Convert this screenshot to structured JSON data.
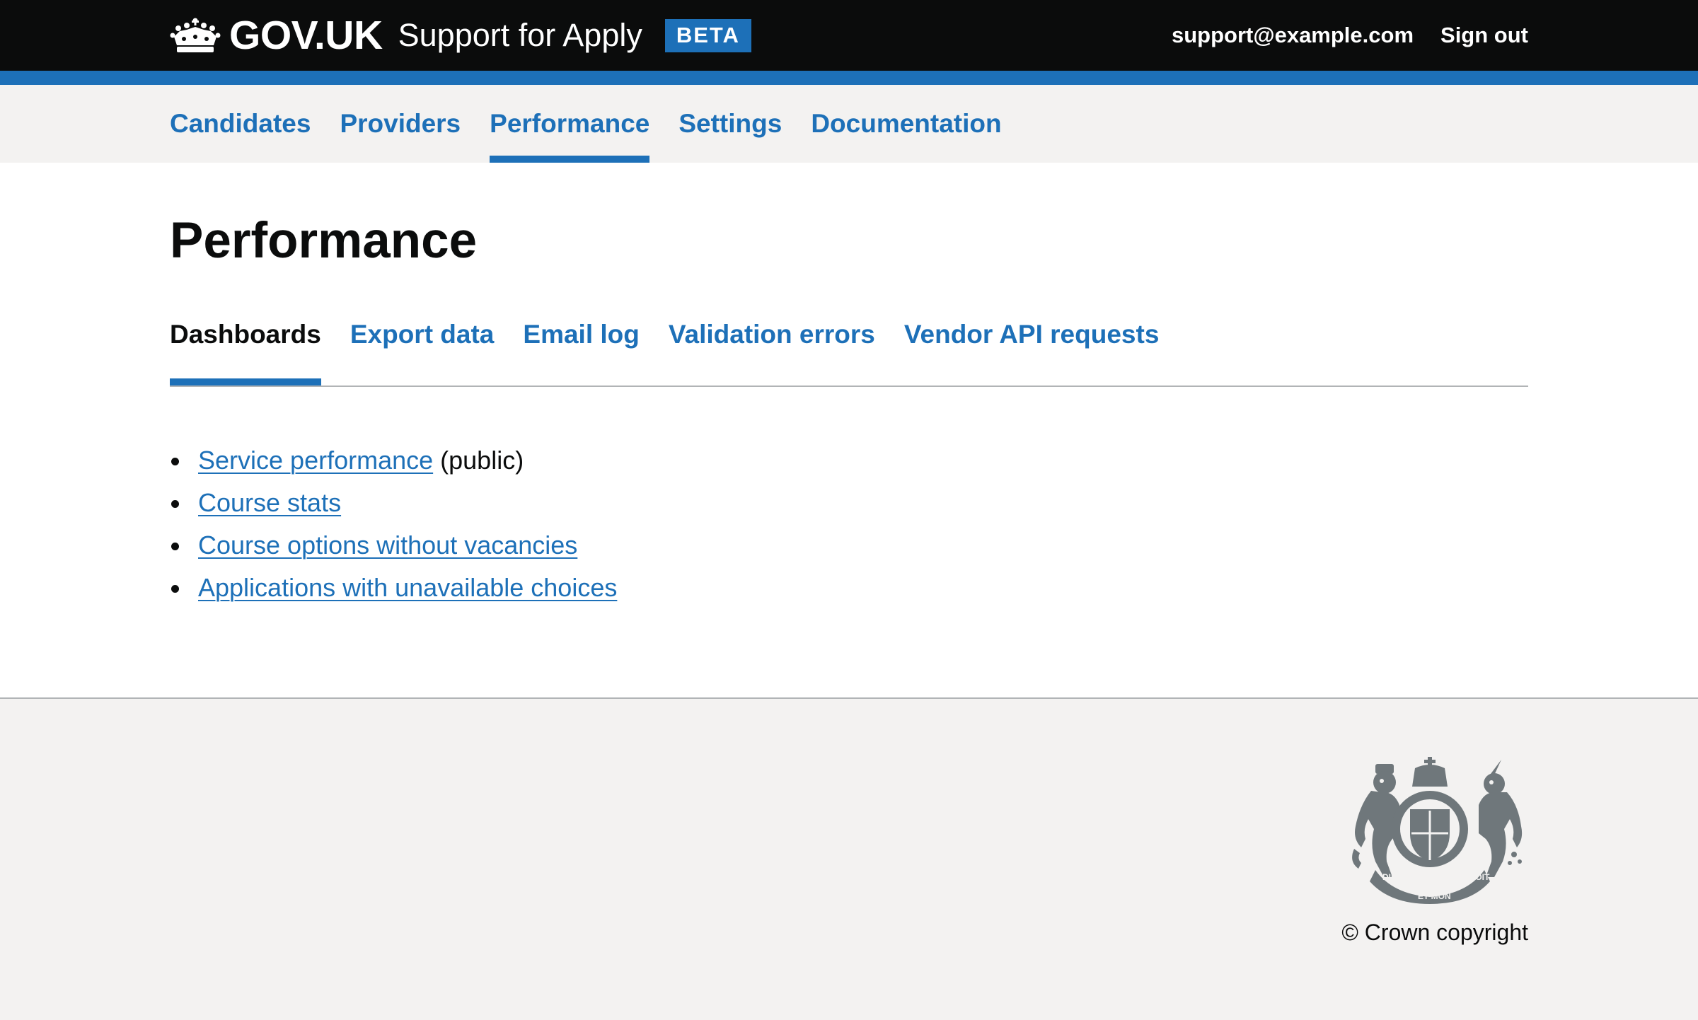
{
  "header": {
    "logotype": "GOV.UK",
    "service_name": "Support for Apply",
    "phase_tag": "BETA",
    "user_email": "support@example.com",
    "sign_out": "Sign out"
  },
  "primary_nav": {
    "items": [
      {
        "label": "Candidates"
      },
      {
        "label": "Providers"
      },
      {
        "label": "Performance",
        "active": true
      },
      {
        "label": "Settings"
      },
      {
        "label": "Documentation"
      }
    ]
  },
  "page": {
    "title": "Performance",
    "tabs": [
      {
        "label": "Dashboards",
        "current": true
      },
      {
        "label": "Export data"
      },
      {
        "label": "Email log"
      },
      {
        "label": "Validation errors"
      },
      {
        "label": "Vendor API requests"
      }
    ],
    "links": [
      {
        "label": "Service performance",
        "suffix": " (public)"
      },
      {
        "label": "Course stats"
      },
      {
        "label": "Course options without vacancies"
      },
      {
        "label": "Applications with unavailable choices"
      }
    ]
  },
  "footer": {
    "copyright": "© Crown copyright",
    "crest_motto": [
      "DIEU",
      "ET MON",
      "DROIT"
    ]
  },
  "colors": {
    "header_bg": "#0b0c0c",
    "accent_blue": "#1d70b8",
    "link_blue": "#1d70b8",
    "footer_bg": "#f3f2f1",
    "crest_grey": "#6f777b"
  },
  "icons": {
    "crown": "crown-icon",
    "crest": "royal-coat-of-arms"
  }
}
